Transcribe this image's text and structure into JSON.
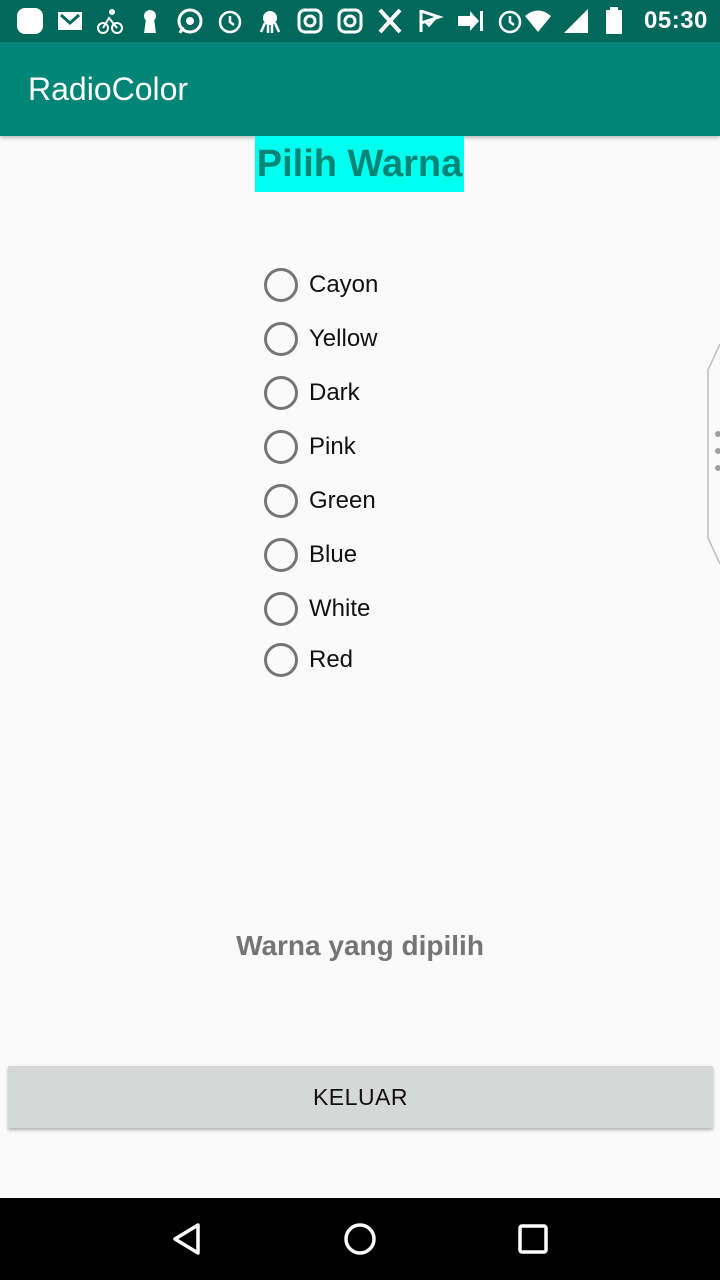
{
  "status_bar": {
    "time": "05:30",
    "icons": [
      "app-icon",
      "gmail-icon",
      "cycling-icon",
      "keyhole-icon",
      "whatsapp-icon",
      "alarm-icon",
      "octopus-icon",
      "instagram-icon",
      "instagram-icon",
      "x-icon",
      "check-flag-icon",
      "forward-icon",
      "alarm-icon",
      "wifi-icon",
      "signal-icon",
      "battery-icon"
    ]
  },
  "app_bar": {
    "title": "RadioColor"
  },
  "heading": {
    "text": "Pilih Warna",
    "bg_color": "#00ffee",
    "text_color": "#008577"
  },
  "radio_options": [
    {
      "label": "Cayon",
      "selected": false
    },
    {
      "label": "Yellow",
      "selected": false
    },
    {
      "label": "Dark",
      "selected": false
    },
    {
      "label": "Pink",
      "selected": false
    },
    {
      "label": "Green",
      "selected": false
    },
    {
      "label": "Blue",
      "selected": false
    },
    {
      "label": "White",
      "selected": false
    },
    {
      "label": "Red",
      "selected": false
    }
  ],
  "result": {
    "text": "Warna yang dipilih"
  },
  "exit_button": {
    "label": "KELUAR"
  },
  "colors": {
    "status_bar": "#00695c",
    "app_bar": "#008577",
    "background": "#fafafa",
    "button": "#d6d7d7"
  },
  "nav_bar": {
    "buttons": [
      "back-icon",
      "home-icon",
      "recents-icon"
    ]
  }
}
